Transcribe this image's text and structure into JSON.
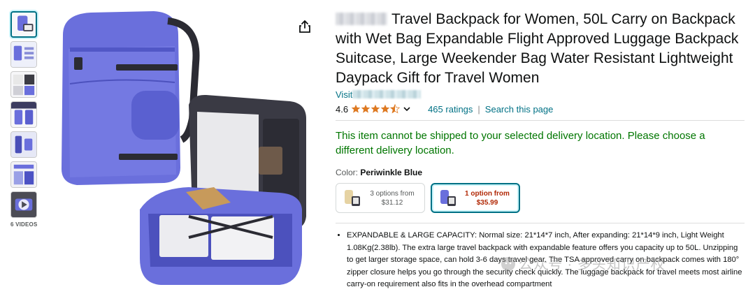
{
  "product": {
    "title": "Travel Backpack for Women, 50L Carry on Backpack with Wet Bag Expandable Flight Approved Luggage Backpack Suitcase, Large Weekender Bag Water Resistant Lightweight Daypack Gift for Travel Women",
    "visit_label": "Visit",
    "rating_value": "4.6",
    "rating_stars": 4.5,
    "ratings_count": "465 ratings",
    "separator": "|",
    "search_page": "Search this page"
  },
  "shipping": {
    "message": "This item cannot be shipped to your selected delivery location. Please choose a different delivery location."
  },
  "color": {
    "label": "Color: ",
    "value": "Periwinkle Blue"
  },
  "options": [
    {
      "line1": "3 options from",
      "line2": "$31.12"
    },
    {
      "line1": "1 option from",
      "line2": "$35.99"
    }
  ],
  "gallery": {
    "videos_label": "6 VIDEOS"
  },
  "bullets": [
    "EXPANDABLE & LARGE CAPACITY: Normal size: 21*14*7 inch, After expanding: 21*14*9 inch, Light Weight 1.08Kg(2.38lb). The extra large travel backpack with expandable feature offers you capacity up to 50L. Unzipping to get larger storage space, can hold 3-6 days travel gear. The TSA approved carry on backpack comes with 180° zipper closure helps you go through the security check quickly. The luggage backpack for travel meets most airline carry-on requirement also fits in the overhead compartment"
  ],
  "watermark": {
    "text": "公众号 · 多头知识产权"
  },
  "colors": {
    "link": "#007185",
    "ship_green": "#007600",
    "price_red": "#b12704",
    "star": "#de7921",
    "bag_blue": "#6a6fdc"
  }
}
